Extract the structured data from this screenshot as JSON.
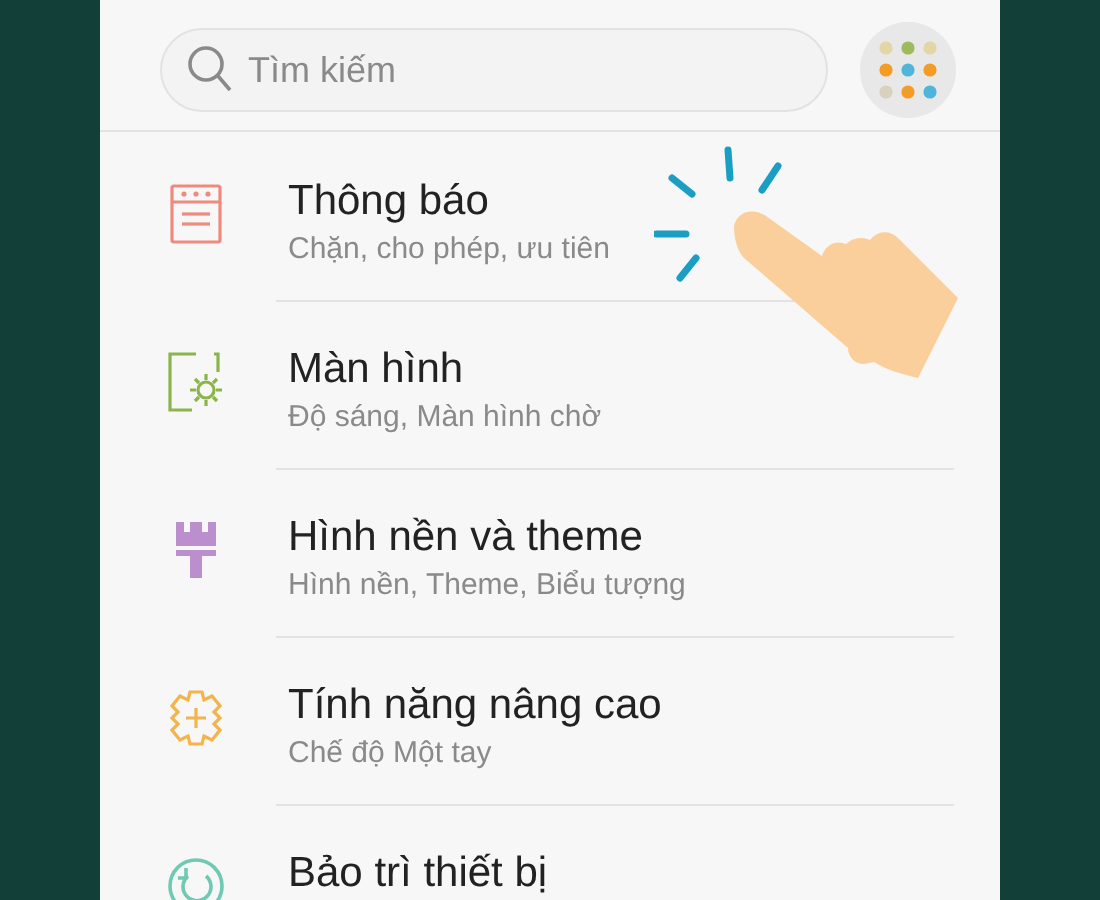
{
  "search": {
    "placeholder": "Tìm kiếm"
  },
  "items": [
    {
      "kind": "notifications",
      "title": "Thông báo",
      "subtitle": "Chặn, cho phép, ưu tiên"
    },
    {
      "kind": "display",
      "title": "Màn hình",
      "subtitle": "Độ sáng, Màn hình chờ"
    },
    {
      "kind": "wallpaper",
      "title": "Hình nền và theme",
      "subtitle": "Hình nền, Theme, Biểu tượng"
    },
    {
      "kind": "advanced",
      "title": "Tính năng nâng cao",
      "subtitle": "Chế độ Một tay"
    },
    {
      "kind": "maintenance",
      "title": "Bảo trì thiết bị"
    }
  ]
}
